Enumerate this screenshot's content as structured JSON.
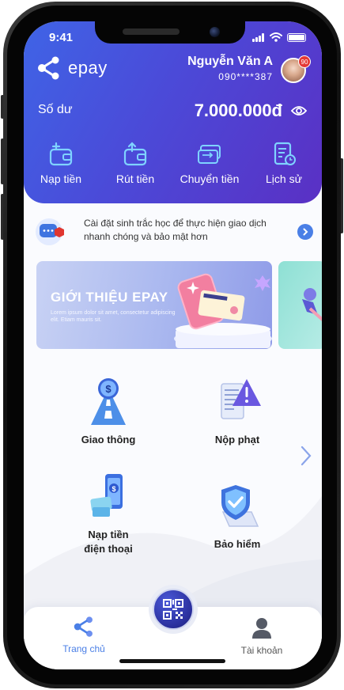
{
  "status_bar": {
    "time": "9:41"
  },
  "brand": {
    "name": "epay"
  },
  "user": {
    "name": "Nguyễn Văn A",
    "phone": "090****387",
    "notification_count": "90"
  },
  "balance": {
    "label": "Số dư",
    "value": "7.000.000đ"
  },
  "quick_actions": [
    {
      "label": "Nạp tiền",
      "icon": "wallet-add-icon"
    },
    {
      "label": "Rút tiền",
      "icon": "wallet-withdraw-icon"
    },
    {
      "label": "Chuyển tiền",
      "icon": "transfer-card-icon"
    },
    {
      "label": "Lịch sử",
      "icon": "history-icon"
    }
  ],
  "notice": {
    "text": "Cài đặt sinh trắc học để thực hiện giao dịch nhanh chóng và bảo mật hơn"
  },
  "banner": {
    "title": "GIỚI THIỆU EPAY",
    "subtitle": "Lorem ipsum dolor sit amet, consectetur adipiscing elit. Etiam mauris sit."
  },
  "services": [
    {
      "label": "Giao thông",
      "icon": "traffic-road-icon"
    },
    {
      "label": "Nộp phạt",
      "icon": "fine-warning-icon"
    },
    {
      "label_line1": "Nạp tiền",
      "label_line2": "điện thoại",
      "icon": "phone-topup-icon"
    },
    {
      "label": "Bảo hiểm",
      "icon": "insurance-shield-icon"
    }
  ],
  "tabbar": {
    "home": "Trang chủ",
    "account": "Tài khoản"
  },
  "colors": {
    "header_start": "#3f64e6",
    "header_end": "#5a30c4",
    "accent": "#4a7fe6",
    "badge": "#e53935"
  }
}
